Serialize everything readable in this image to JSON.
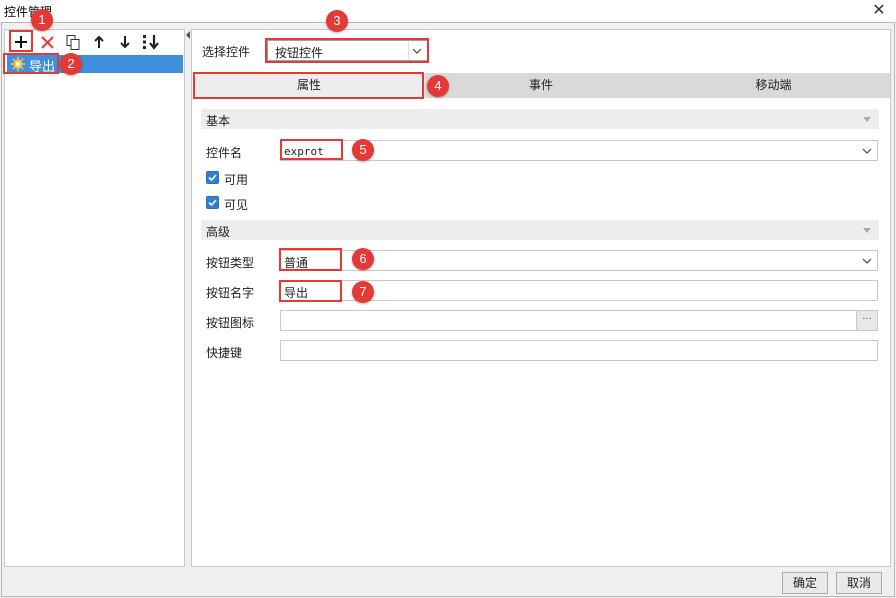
{
  "window": {
    "title": "控件管理",
    "close_glyph": "✕"
  },
  "toolbar": {
    "icons": [
      "add-icon",
      "delete-icon",
      "copy-icon",
      "move-up-icon",
      "move-down-icon",
      "sort-icon"
    ]
  },
  "tree": {
    "items": [
      {
        "label": "导出",
        "icon": "gear-icon"
      }
    ]
  },
  "selector": {
    "label": "选择控件",
    "value": "按钮控件"
  },
  "tabs": [
    {
      "label": "属性",
      "active": true
    },
    {
      "label": "事件",
      "active": false
    },
    {
      "label": "移动端",
      "active": false
    }
  ],
  "basic": {
    "header": "基本",
    "control_name_label": "控件名",
    "control_name_value": "exprot",
    "enabled_label": "可用",
    "enabled": true,
    "visible_label": "可见",
    "visible": true
  },
  "advanced": {
    "header": "高级",
    "button_type_label": "按钮类型",
    "button_type_value": "普通",
    "button_name_label": "按钮名字",
    "button_name_value": "导出",
    "button_icon_label": "按钮图标",
    "button_icon_value": "",
    "button_icon_more": "···",
    "shortcut_label": "快捷键",
    "shortcut_value": ""
  },
  "callouts": [
    "1",
    "2",
    "3",
    "4",
    "5",
    "6",
    "7"
  ],
  "footer": {
    "ok_label": "确定",
    "cancel_label": "取消"
  },
  "colors": {
    "accent": "#3f8fda",
    "callout": "#e53935",
    "checkbox": "#2f7fd3"
  }
}
